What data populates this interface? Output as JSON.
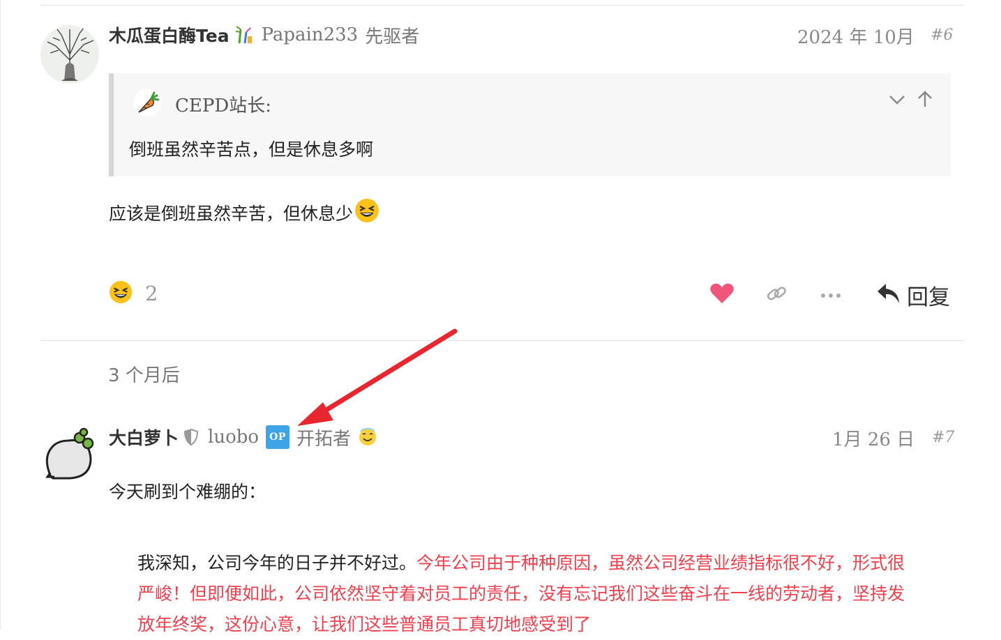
{
  "posts": [
    {
      "display_name": "木瓜蛋白酶Tea",
      "username": "Papain233",
      "user_title": "先驱者",
      "date": "2024 年 10月",
      "post_number": "#6",
      "quote": {
        "author": "CEPD站长:",
        "text": "倒班虽然辛苦点，但是休息多啊"
      },
      "body": "应该是倒班虽然辛苦，但休息少",
      "reaction": {
        "emoji": "laughing-emoji",
        "count": "2"
      },
      "actions": {
        "reply_label": "回复"
      }
    },
    {
      "display_name": "大白萝卜",
      "username": "luobo",
      "op_badge": "OP",
      "user_title": "开拓者",
      "date": "1月 26 日",
      "post_number": "#7",
      "body": "今天刷到个难绷的：",
      "blockquote": {
        "part1": "我深知，公司今年的日子并不好过。",
        "part2": "今年公司由于种种原因，虽然公司经营业绩指标很不好，形式很严峻！但即便如此，公司依然坚守着对员工的责任，没有忘记我们这些奋斗在一线的劳动者，坚持发放年终奖，这份心意，让我们这些普通员工真切地感受到了"
      }
    }
  ],
  "time_gap": "3 个月后",
  "colors": {
    "like": "#f1567a",
    "op_badge": "#3fa3e8",
    "highlight_text": "#f0404e",
    "annotation_arrow": "#e8262f"
  }
}
